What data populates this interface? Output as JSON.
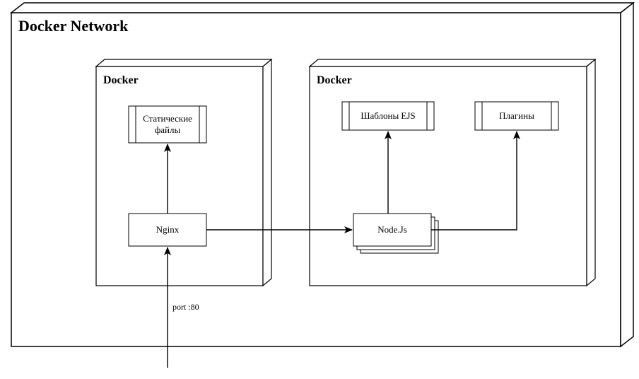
{
  "diagram": {
    "outer_title": "Docker Network",
    "container_left_title": "Docker",
    "container_right_title": "Docker",
    "static_files_label_line1": "Статические",
    "static_files_label_line2": "файлы",
    "nginx_label": "Nginx",
    "nodejs_label": "Node.Js",
    "ejs_label": "Шаблоны EJS",
    "plugins_label": "Плагины",
    "port_label": "port :80"
  }
}
